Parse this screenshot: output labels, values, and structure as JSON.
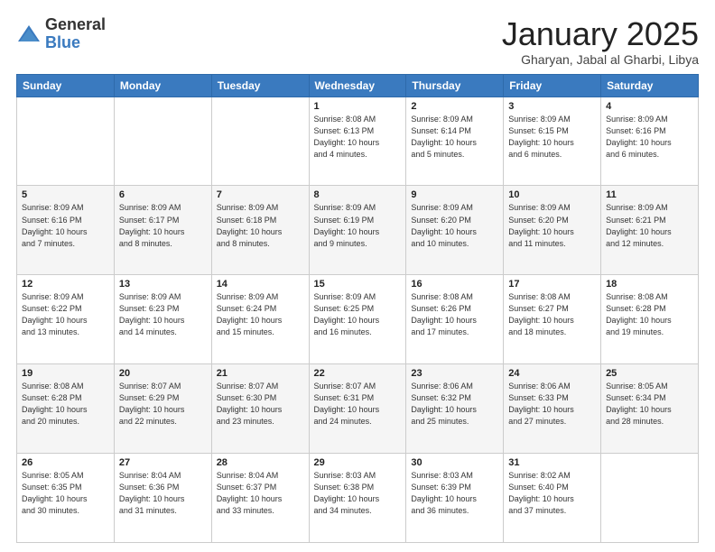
{
  "header": {
    "logo": {
      "general": "General",
      "blue": "Blue"
    },
    "title": "January 2025",
    "location": "Gharyan, Jabal al Gharbi, Libya"
  },
  "days_of_week": [
    "Sunday",
    "Monday",
    "Tuesday",
    "Wednesday",
    "Thursday",
    "Friday",
    "Saturday"
  ],
  "weeks": [
    [
      {
        "day": "",
        "info": ""
      },
      {
        "day": "",
        "info": ""
      },
      {
        "day": "",
        "info": ""
      },
      {
        "day": "1",
        "info": "Sunrise: 8:08 AM\nSunset: 6:13 PM\nDaylight: 10 hours\nand 4 minutes."
      },
      {
        "day": "2",
        "info": "Sunrise: 8:09 AM\nSunset: 6:14 PM\nDaylight: 10 hours\nand 5 minutes."
      },
      {
        "day": "3",
        "info": "Sunrise: 8:09 AM\nSunset: 6:15 PM\nDaylight: 10 hours\nand 6 minutes."
      },
      {
        "day": "4",
        "info": "Sunrise: 8:09 AM\nSunset: 6:16 PM\nDaylight: 10 hours\nand 6 minutes."
      }
    ],
    [
      {
        "day": "5",
        "info": "Sunrise: 8:09 AM\nSunset: 6:16 PM\nDaylight: 10 hours\nand 7 minutes."
      },
      {
        "day": "6",
        "info": "Sunrise: 8:09 AM\nSunset: 6:17 PM\nDaylight: 10 hours\nand 8 minutes."
      },
      {
        "day": "7",
        "info": "Sunrise: 8:09 AM\nSunset: 6:18 PM\nDaylight: 10 hours\nand 8 minutes."
      },
      {
        "day": "8",
        "info": "Sunrise: 8:09 AM\nSunset: 6:19 PM\nDaylight: 10 hours\nand 9 minutes."
      },
      {
        "day": "9",
        "info": "Sunrise: 8:09 AM\nSunset: 6:20 PM\nDaylight: 10 hours\nand 10 minutes."
      },
      {
        "day": "10",
        "info": "Sunrise: 8:09 AM\nSunset: 6:20 PM\nDaylight: 10 hours\nand 11 minutes."
      },
      {
        "day": "11",
        "info": "Sunrise: 8:09 AM\nSunset: 6:21 PM\nDaylight: 10 hours\nand 12 minutes."
      }
    ],
    [
      {
        "day": "12",
        "info": "Sunrise: 8:09 AM\nSunset: 6:22 PM\nDaylight: 10 hours\nand 13 minutes."
      },
      {
        "day": "13",
        "info": "Sunrise: 8:09 AM\nSunset: 6:23 PM\nDaylight: 10 hours\nand 14 minutes."
      },
      {
        "day": "14",
        "info": "Sunrise: 8:09 AM\nSunset: 6:24 PM\nDaylight: 10 hours\nand 15 minutes."
      },
      {
        "day": "15",
        "info": "Sunrise: 8:09 AM\nSunset: 6:25 PM\nDaylight: 10 hours\nand 16 minutes."
      },
      {
        "day": "16",
        "info": "Sunrise: 8:08 AM\nSunset: 6:26 PM\nDaylight: 10 hours\nand 17 minutes."
      },
      {
        "day": "17",
        "info": "Sunrise: 8:08 AM\nSunset: 6:27 PM\nDaylight: 10 hours\nand 18 minutes."
      },
      {
        "day": "18",
        "info": "Sunrise: 8:08 AM\nSunset: 6:28 PM\nDaylight: 10 hours\nand 19 minutes."
      }
    ],
    [
      {
        "day": "19",
        "info": "Sunrise: 8:08 AM\nSunset: 6:28 PM\nDaylight: 10 hours\nand 20 minutes."
      },
      {
        "day": "20",
        "info": "Sunrise: 8:07 AM\nSunset: 6:29 PM\nDaylight: 10 hours\nand 22 minutes."
      },
      {
        "day": "21",
        "info": "Sunrise: 8:07 AM\nSunset: 6:30 PM\nDaylight: 10 hours\nand 23 minutes."
      },
      {
        "day": "22",
        "info": "Sunrise: 8:07 AM\nSunset: 6:31 PM\nDaylight: 10 hours\nand 24 minutes."
      },
      {
        "day": "23",
        "info": "Sunrise: 8:06 AM\nSunset: 6:32 PM\nDaylight: 10 hours\nand 25 minutes."
      },
      {
        "day": "24",
        "info": "Sunrise: 8:06 AM\nSunset: 6:33 PM\nDaylight: 10 hours\nand 27 minutes."
      },
      {
        "day": "25",
        "info": "Sunrise: 8:05 AM\nSunset: 6:34 PM\nDaylight: 10 hours\nand 28 minutes."
      }
    ],
    [
      {
        "day": "26",
        "info": "Sunrise: 8:05 AM\nSunset: 6:35 PM\nDaylight: 10 hours\nand 30 minutes."
      },
      {
        "day": "27",
        "info": "Sunrise: 8:04 AM\nSunset: 6:36 PM\nDaylight: 10 hours\nand 31 minutes."
      },
      {
        "day": "28",
        "info": "Sunrise: 8:04 AM\nSunset: 6:37 PM\nDaylight: 10 hours\nand 33 minutes."
      },
      {
        "day": "29",
        "info": "Sunrise: 8:03 AM\nSunset: 6:38 PM\nDaylight: 10 hours\nand 34 minutes."
      },
      {
        "day": "30",
        "info": "Sunrise: 8:03 AM\nSunset: 6:39 PM\nDaylight: 10 hours\nand 36 minutes."
      },
      {
        "day": "31",
        "info": "Sunrise: 8:02 AM\nSunset: 6:40 PM\nDaylight: 10 hours\nand 37 minutes."
      },
      {
        "day": "",
        "info": ""
      }
    ]
  ]
}
